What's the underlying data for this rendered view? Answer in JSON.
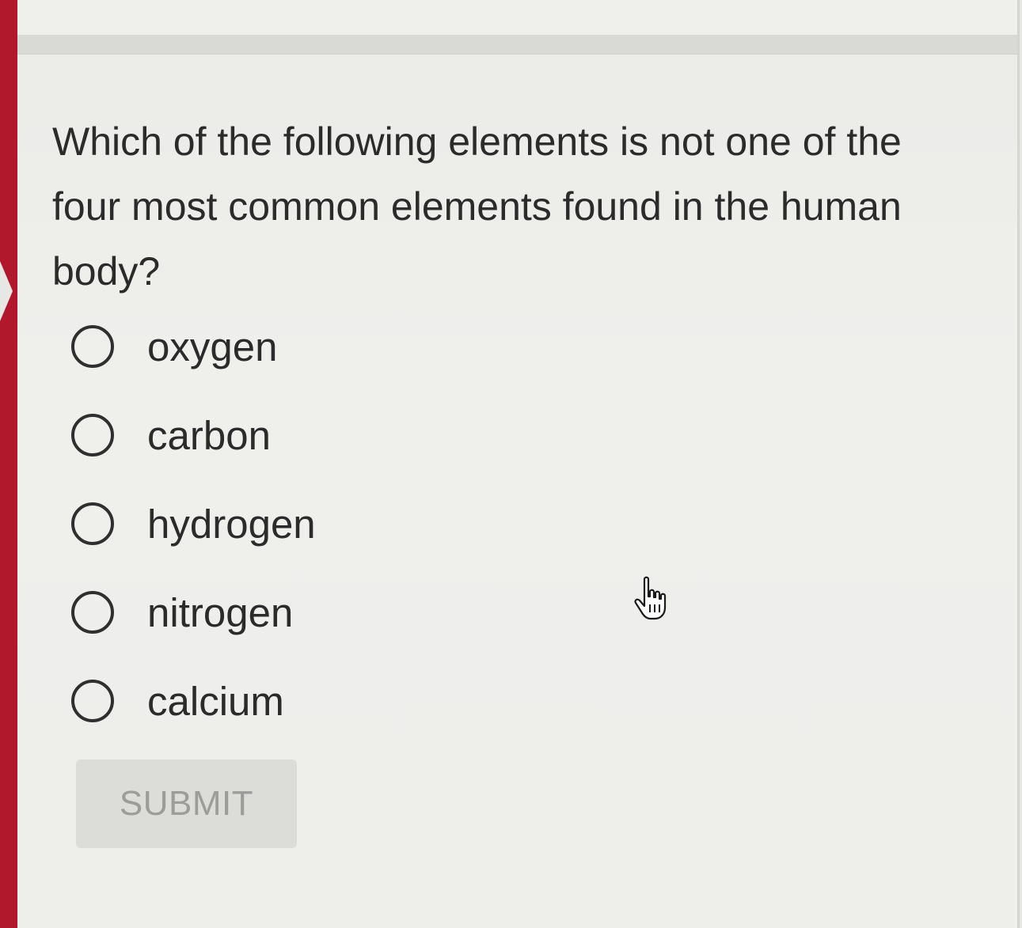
{
  "question": {
    "text": "Which of the following elements is not one of the four most common elements found in the human body?"
  },
  "options": [
    {
      "label": "oxygen",
      "selected": false
    },
    {
      "label": "carbon",
      "selected": false
    },
    {
      "label": "hydrogen",
      "selected": false
    },
    {
      "label": "nitrogen",
      "selected": false
    },
    {
      "label": "calcium",
      "selected": false
    }
  ],
  "submit": {
    "label": "SUBMIT",
    "disabled": true
  },
  "colors": {
    "accent_bar": "#b2182b",
    "background": "#eeeeeb",
    "text": "#2b2b2b",
    "submit_bg": "#dcdcd9",
    "submit_text": "#9c9c9a"
  },
  "cursor": {
    "icon": "hand-pointer-icon"
  }
}
